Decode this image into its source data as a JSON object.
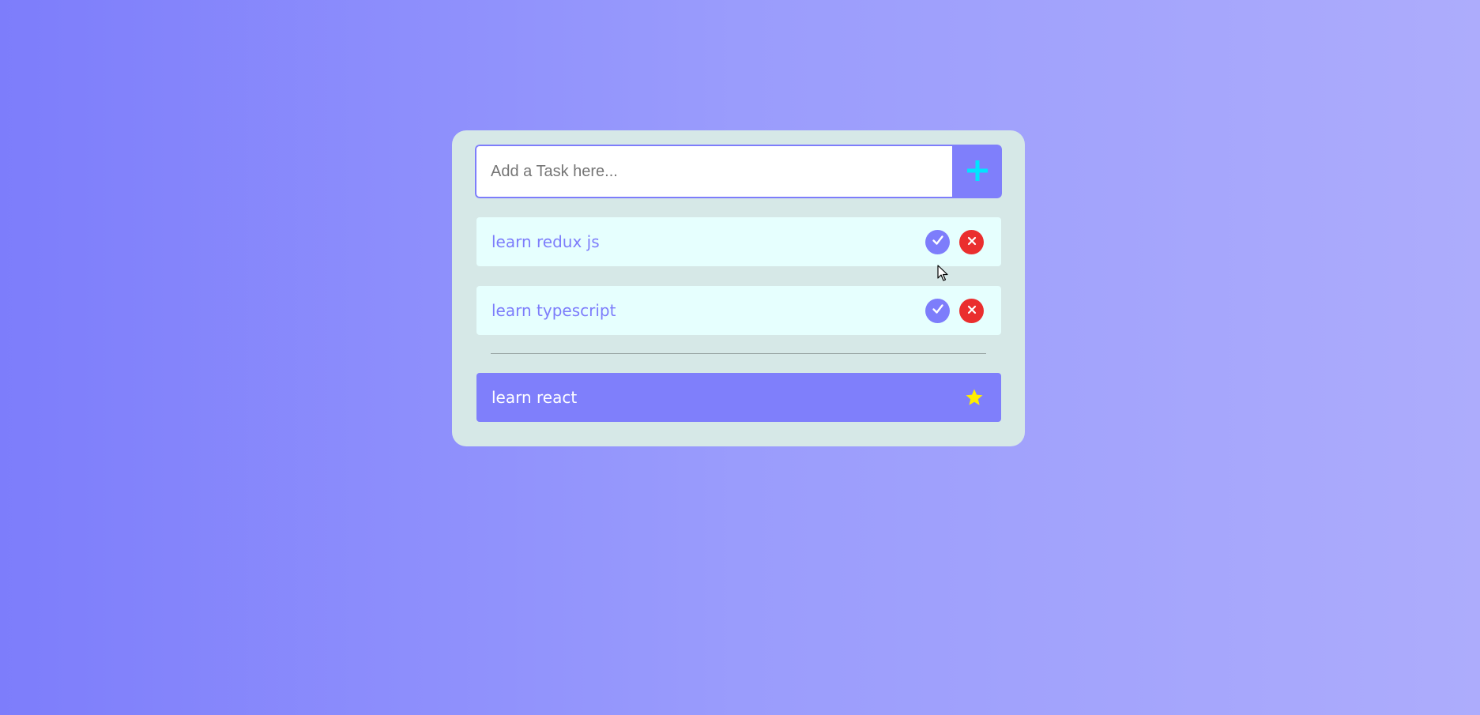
{
  "input": {
    "placeholder": "Add a Task here...",
    "value": ""
  },
  "add_button": {
    "icon": "plus-icon"
  },
  "tasks": [
    {
      "label": "learn redux js",
      "status": "pending"
    },
    {
      "label": "learn typescript",
      "status": "pending"
    }
  ],
  "completed": [
    {
      "label": "learn react",
      "icon": "star-icon"
    }
  ],
  "colors": {
    "accent": "#7f7ffb",
    "plus": "#00e5ff",
    "delete": "#ea2e2e",
    "star": "#ffee00",
    "card": "#d6e8e7",
    "task_bg": "#e6fffe"
  }
}
